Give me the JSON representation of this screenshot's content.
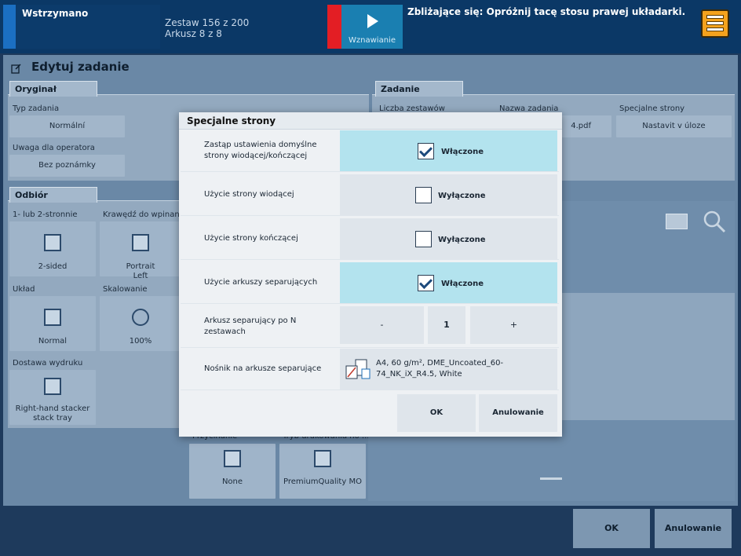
{
  "topbar": {
    "status": "Wstrzymano",
    "set_count": "Zestaw 156 z 200",
    "sheet_count": "Arkusz 8 z 8",
    "resume_label": "Wznawianie",
    "upcoming": "Zbliżające się: Opróżnij tacę stosu prawej układarki."
  },
  "page": {
    "title": "Edytuj zadanie"
  },
  "original": {
    "tab": "Oryginał",
    "job_type_label": "Typ zadania",
    "job_type_value": "Normální",
    "operator_note_label": "Uwaga dla operatora",
    "operator_note_value": "Bez poznámky"
  },
  "job": {
    "tab": "Zadanie",
    "sets_label": "Liczba zestawów",
    "name_label": "Nazwa zadania",
    "name_value_fragment": "4.pdf",
    "special_label": "Specjalne strony",
    "special_value": "Nastavit v úloze"
  },
  "output": {
    "tab": "Odbiór",
    "sides_label": "1- lub 2-stronnie",
    "sides_value": "2-sided",
    "binding_label": "Krawędź do wpinania",
    "binding_value_1": "Portrait",
    "binding_value_2": "Left",
    "layout_label": "Układ",
    "layout_value": "Normal",
    "scaling_label": "Skalowanie",
    "scaling_value": "100%",
    "delivery_label": "Dostawa wydruku",
    "delivery_value_1": "Right-hand stacker",
    "delivery_value_2": "stack tray",
    "trim_label": "Przycinanie",
    "trim_value": "None",
    "print_mode_label": "Tryb drukowania no ...",
    "print_mode_value": "PremiumQuality MO"
  },
  "footer": {
    "ok": "OK",
    "cancel": "Anulowanie"
  },
  "modal": {
    "title": "Specjalne strony",
    "rows": [
      {
        "label": "Zastąp ustawienia domyślne strony wiodącej/kończącej",
        "state": "Włączone",
        "checked": true
      },
      {
        "label": "Użycie strony wiodącej",
        "state": "Wyłączone",
        "checked": false
      },
      {
        "label": "Użycie strony kończącej",
        "state": "Wyłączone",
        "checked": false
      },
      {
        "label": "Użycie arkuszy separujących",
        "state": "Włączone",
        "checked": true
      }
    ],
    "separator_every_label": "Arkusz separujący po N zestawach",
    "minus": "-",
    "separator_every_value": "1",
    "plus": "+",
    "separator_media_label": "Nośnik na arkusze separujące",
    "separator_media_value": "A4, 60 g/m², DME_Uncoated_60-74_NK_iX_R4.5, White",
    "ok": "OK",
    "cancel": "Anulowanie"
  }
}
